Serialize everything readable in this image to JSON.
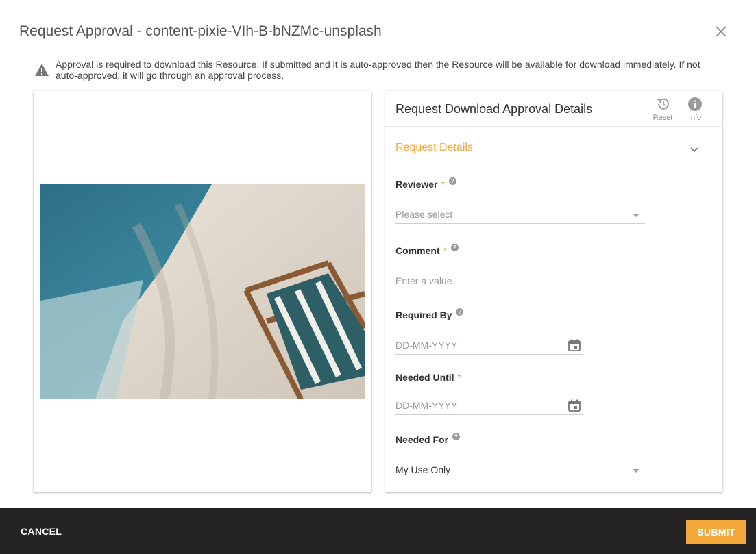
{
  "dialog": {
    "title": "Request Approval - content-pixie-VIh-B-bNZMc-unsplash",
    "close_icon": "close-icon"
  },
  "notice": {
    "icon": "warning-icon",
    "text": "Approval is required to download this Resource. If submitted and it is auto-approved then the Resource will be available for download immediately. If not auto-approved, it will go through an approval process."
  },
  "preview": {
    "description_icon": "image-preview"
  },
  "panel": {
    "title": "Request Download Approval Details",
    "reset_label": "Reset",
    "info_label": "Info",
    "section_title": "Request Details"
  },
  "fields": {
    "reviewer": {
      "label": "Reviewer",
      "required": "*",
      "placeholder": "Please select"
    },
    "comment": {
      "label": "Comment",
      "required": "*",
      "placeholder": "Enter a value"
    },
    "required_by": {
      "label": "Required By",
      "placeholder": "DD-MM-YYYY"
    },
    "needed_until": {
      "label": "Needed Until",
      "required": "*",
      "placeholder": "DD-MM-YYYY"
    },
    "needed_for": {
      "label": "Needed For",
      "value": "My Use Only"
    },
    "help_glyph": "?"
  },
  "footer": {
    "cancel_label": "CANCEL",
    "submit_label": "SUBMIT"
  },
  "colors": {
    "accent": "#f5a83a",
    "footer_bg": "#262324"
  }
}
